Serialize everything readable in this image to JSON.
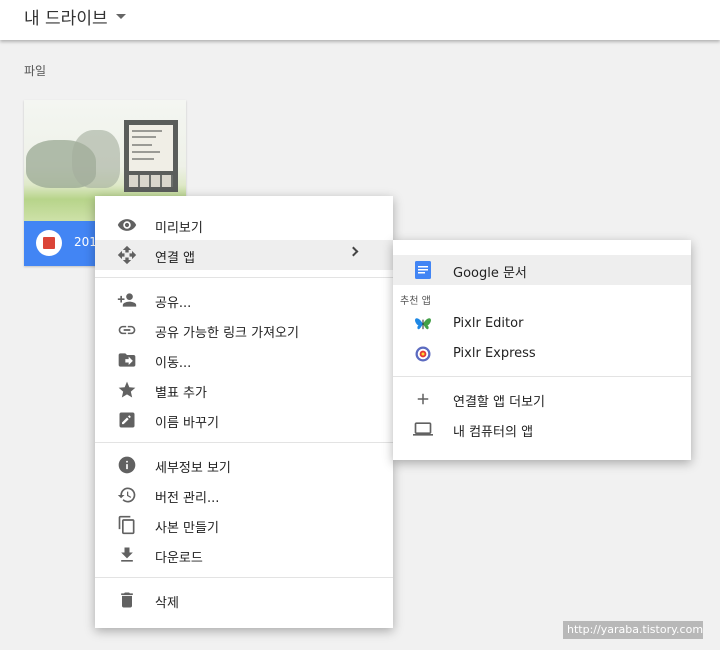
{
  "header": {
    "title": "내 드라이브"
  },
  "section": {
    "label": "파일"
  },
  "file": {
    "name": "201"
  },
  "context_menu": {
    "items": [
      {
        "label": "미리보기",
        "icon": "eye-icon"
      },
      {
        "label": "연결 앱",
        "icon": "open-with-icon"
      },
      {
        "label": "공유...",
        "icon": "person-add-icon"
      },
      {
        "label": "공유 가능한 링크 가져오기",
        "icon": "link-icon"
      },
      {
        "label": "이동...",
        "icon": "move-icon"
      },
      {
        "label": "별표 추가",
        "icon": "star-icon"
      },
      {
        "label": "이름 바꾸기",
        "icon": "edit-icon"
      },
      {
        "label": "세부정보 보기",
        "icon": "info-icon"
      },
      {
        "label": "버전 관리...",
        "icon": "history-icon"
      },
      {
        "label": "사본 만들기",
        "icon": "copy-icon"
      },
      {
        "label": "다운로드",
        "icon": "download-icon"
      },
      {
        "label": "삭제",
        "icon": "trash-icon"
      }
    ]
  },
  "submenu": {
    "google_docs": "Google 문서",
    "recommended_header": "추천 앱",
    "pixlr_editor": "Pixlr Editor",
    "pixlr_express": "Pixlr Express",
    "more_apps": "연결할 앱 더보기",
    "my_computer": "내 컴퓨터의 앱"
  },
  "watermark": "http://yaraba.tistory.com",
  "colors": {
    "accent_blue": "#4285f4",
    "image_red": "#db4437",
    "icon_grey": "#616161"
  }
}
